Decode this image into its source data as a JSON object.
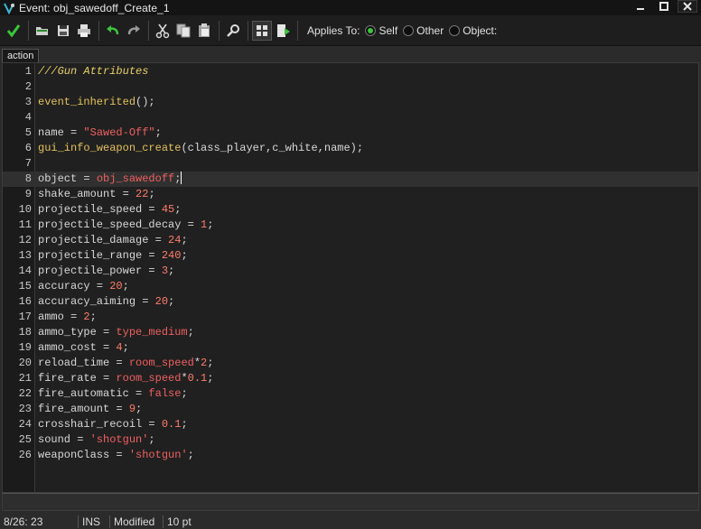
{
  "window": {
    "title": "Event: obj_sawedoff_Create_1",
    "minimize": "—",
    "maximize": "□",
    "close": "✕"
  },
  "toolbar": {
    "applies_to_label": "Applies To:",
    "options": [
      {
        "label": "Self",
        "checked": true
      },
      {
        "label": "Other",
        "checked": false
      },
      {
        "label": "Object:",
        "checked": false
      }
    ]
  },
  "tabs": [
    {
      "label": "action"
    }
  ],
  "editor": {
    "current_line": 8,
    "lines": [
      {
        "n": "1"
      },
      {
        "n": "2"
      },
      {
        "n": "3"
      },
      {
        "n": "4"
      },
      {
        "n": "5"
      },
      {
        "n": "6"
      },
      {
        "n": "7"
      },
      {
        "n": "8"
      },
      {
        "n": "9"
      },
      {
        "n": "10"
      },
      {
        "n": "11"
      },
      {
        "n": "12"
      },
      {
        "n": "13"
      },
      {
        "n": "14"
      },
      {
        "n": "15"
      },
      {
        "n": "16"
      },
      {
        "n": "17"
      },
      {
        "n": "18"
      },
      {
        "n": "19"
      },
      {
        "n": "20"
      },
      {
        "n": "21"
      },
      {
        "n": "22"
      },
      {
        "n": "23"
      },
      {
        "n": "24"
      },
      {
        "n": "25"
      },
      {
        "n": "26"
      }
    ],
    "code": {
      "l1": "///Gun Attributes",
      "l3_func": "event_inherited",
      "l3_rest": "();",
      "l5_a": "name = ",
      "l5_str": "\"Sawed-Off\"",
      "l5_b": ";",
      "l6_func": "gui_info_weapon_create",
      "l6_rest": "(class_player,c_white,name);",
      "l8_a": "object = ",
      "l8_res": "obj_sawedoff",
      "l8_b": ";",
      "l9_a": "shake_amount = ",
      "l9_num": "22",
      "l9_b": ";",
      "l10_a": "projectile_speed = ",
      "l10_num": "45",
      "l10_b": ";",
      "l11_a": "projectile_speed_decay = ",
      "l11_num": "1",
      "l11_b": ";",
      "l12_a": "projectile_damage = ",
      "l12_num": "24",
      "l12_b": ";",
      "l13_a": "projectile_range = ",
      "l13_num": "240",
      "l13_b": ";",
      "l14_a": "projectile_power = ",
      "l14_num": "3",
      "l14_b": ";",
      "l15_a": "accuracy = ",
      "l15_num": "20",
      "l15_b": ";",
      "l16_a": "accuracy_aiming = ",
      "l16_num": "20",
      "l16_b": ";",
      "l17_a": "ammo = ",
      "l17_num": "2",
      "l17_b": ";",
      "l18_a": "ammo_type = ",
      "l18_res": "type_medium",
      "l18_b": ";",
      "l19_a": "ammo_cost = ",
      "l19_num": "4",
      "l19_b": ";",
      "l20_a": "reload_time = ",
      "l20_res": "room_speed",
      "l20_op": "*",
      "l20_num": "2",
      "l20_b": ";",
      "l21_a": "fire_rate = ",
      "l21_res": "room_speed",
      "l21_op": "*",
      "l21_num": "0.1",
      "l21_b": ";",
      "l22_a": "fire_automatic = ",
      "l22_res": "false",
      "l22_b": ";",
      "l23_a": "fire_amount = ",
      "l23_num": "9",
      "l23_b": ";",
      "l24_a": "crosshair_recoil = ",
      "l24_num": "0.1",
      "l24_b": ";",
      "l25_a": "sound = ",
      "l25_str": "'shotgun'",
      "l25_b": ";",
      "l26_a": "weaponClass = ",
      "l26_str": "'shotgun'",
      "l26_b": ";"
    }
  },
  "status": {
    "position": "8/26: 23",
    "mode": "INS",
    "state": "Modified",
    "font_size": "10 pt"
  },
  "colors": {
    "background": "#2b2b2b",
    "editor_bg": "#202020",
    "comment": "#e8d064",
    "string": "#f06060",
    "number": "#ff7c6a",
    "check_green": "#39c739"
  }
}
